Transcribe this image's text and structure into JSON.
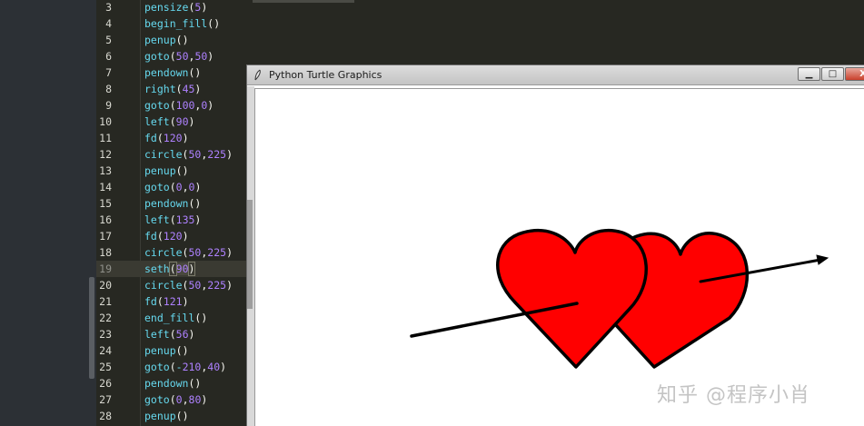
{
  "editor": {
    "lines": [
      {
        "n": "3",
        "code": "pensize(5)"
      },
      {
        "n": "4",
        "code": "begin_fill()"
      },
      {
        "n": "5",
        "code": "penup()"
      },
      {
        "n": "6",
        "code": "goto(50,50)"
      },
      {
        "n": "7",
        "code": "pendown()"
      },
      {
        "n": "8",
        "code": "right(45)"
      },
      {
        "n": "9",
        "code": "goto(100,0)"
      },
      {
        "n": "10",
        "code": "left(90)"
      },
      {
        "n": "11",
        "code": "fd(120)"
      },
      {
        "n": "12",
        "code": "circle(50,225)"
      },
      {
        "n": "13",
        "code": "penup()"
      },
      {
        "n": "14",
        "code": "goto(0,0)"
      },
      {
        "n": "15",
        "code": "pendown()"
      },
      {
        "n": "16",
        "code": "left(135)"
      },
      {
        "n": "17",
        "code": "fd(120)"
      },
      {
        "n": "18",
        "code": "circle(50,225)"
      },
      {
        "n": "19",
        "code": "seth(90)",
        "current": true
      },
      {
        "n": "20",
        "code": "circle(50,225)"
      },
      {
        "n": "21",
        "code": "fd(121)"
      },
      {
        "n": "22",
        "code": "end_fill()"
      },
      {
        "n": "23",
        "code": "left(56)"
      },
      {
        "n": "24",
        "code": "penup()"
      },
      {
        "n": "25",
        "code": "goto(-210,40)"
      },
      {
        "n": "26",
        "code": "pendown()"
      },
      {
        "n": "27",
        "code": "goto(0,80)"
      },
      {
        "n": "28",
        "code": "penup()"
      }
    ]
  },
  "turtle_window": {
    "title": "Python Turtle Graphics",
    "minimize_glyph": "▁",
    "maximize_glyph": "□",
    "close_glyph": "X",
    "heart_fill": "#ff0000",
    "stroke": "#000000"
  },
  "watermark": "知乎 @程序小肖"
}
